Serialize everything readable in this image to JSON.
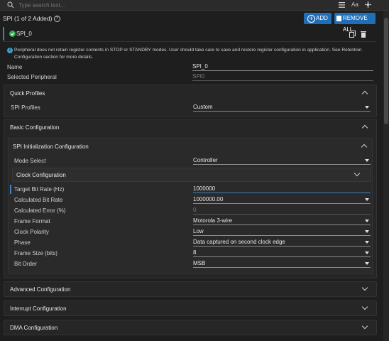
{
  "search": {
    "placeholder": "Type search text..."
  },
  "header": {
    "title": "SPI (1 of 2 Added)",
    "add_label": "ADD",
    "remove_all_label": "REMOVE ALL"
  },
  "instance": {
    "name": "SPI_0"
  },
  "info": {
    "text": "Peripheral does not retain register contents in STOP or STANDBY modes. User should take care to save and restore register configuration in application. See Retention Configuration section for more details."
  },
  "fields": {
    "name_label": "Name",
    "name_value": "SPI_0",
    "selected_label": "Selected Peripheral",
    "selected_value": "SPI0"
  },
  "quick_profiles": {
    "title": "Quick Profiles",
    "profiles_label": "SPI Profiles",
    "profiles_value": "Custom"
  },
  "basic": {
    "title": "Basic Configuration",
    "init_title": "SPI Initialization Configuration",
    "mode_label": "Mode Select",
    "mode_value": "Controller",
    "clock_title": "Clock Configuration",
    "rows": [
      {
        "label": "Target Bit Rate (Hz)",
        "value": "1000000"
      },
      {
        "label": "Calculated Bit Rate",
        "value": "1000000.00"
      },
      {
        "label": "Calculated Error (%)",
        "value": "0"
      },
      {
        "label": "Frame Format",
        "value": "Motorola 3-wire"
      },
      {
        "label": "Clock Polarity",
        "value": "Low"
      },
      {
        "label": "Phase",
        "value": "Data captured on second clock edge"
      },
      {
        "label": "Frame Size (bits)",
        "value": "8"
      },
      {
        "label": "Bit Order",
        "value": "MSB"
      }
    ]
  },
  "collapsed": {
    "advanced": "Advanced Configuration",
    "interrupt": "Interrupt Configuration",
    "dma": "DMA Configuration"
  },
  "colors": {
    "accent": "#1f6fb8",
    "success": "#2fae4e",
    "bg": "#1e1e1e"
  },
  "icons": [
    "search-icon",
    "list-icon",
    "font-size-icon",
    "settings-icon",
    "help-icon",
    "plus-circle-icon",
    "delete-icon",
    "check-circle-icon",
    "copy-icon",
    "trash-icon",
    "info-icon"
  ]
}
